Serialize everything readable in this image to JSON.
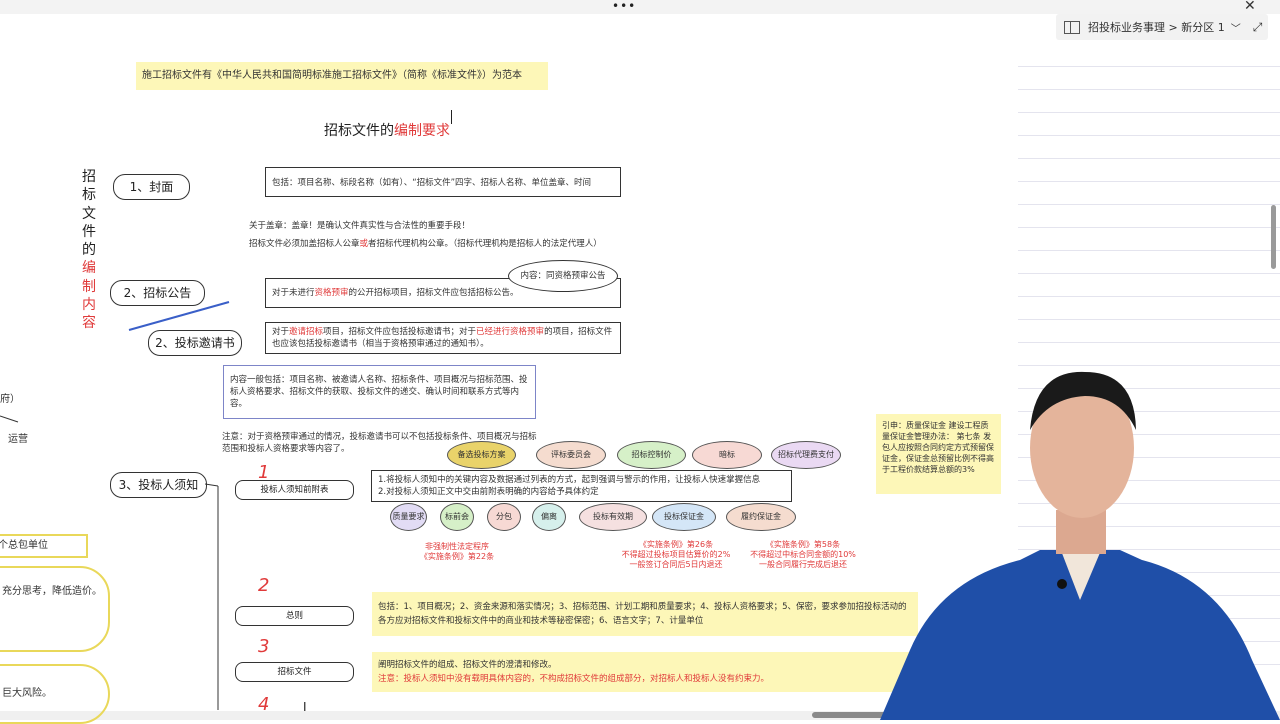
{
  "window": {
    "breadcrumb": "招投标业务事理 > 新分区 1"
  },
  "page": {
    "top_note": "施工招标文件有《中华人民共和国简明标准施工招标文件》（简称《标准文件》）为范本",
    "title_black": "招标文件的",
    "title_red": "编制要求",
    "vertical_title_black": [
      "招",
      "标",
      "文",
      "件",
      "的"
    ],
    "vertical_title_red": [
      "编",
      "制",
      "内",
      "容"
    ],
    "sections": {
      "cover": {
        "label": "1、封面",
        "content": "包括：项目名称、标段名称（如有）、“招标文件”四字、招标人名称、单位盖章、时间",
        "note1": "关于盖章：盖章！是确认文件真实性与合法性的重要手段！",
        "note2_a": "招标文件必须加盖招标人公章",
        "note2_red": "或",
        "note2_b": "者招标代理机构公章。（招标代理机构是招标人的法定代理人）"
      },
      "announcement": {
        "label": "2、招标公告",
        "bubble": "内容：同资格预审公告",
        "content_a": "对于未进行",
        "content_red": "资格预审",
        "content_b": "的公开招标项目，招标文件应包括招标公告。"
      },
      "invitation": {
        "label": "2、投标邀请书",
        "content_a": "对于",
        "content_red1": "邀请招标",
        "content_b": "项目，招标文件应包括投标邀请书；对于",
        "content_red2": "已经进行资格预审",
        "content_c": "的项目，招标文件也应该包括投标邀请书（相当于资格预审通过的通知书）。",
        "detail": "内容一般包括：项目名称、被邀请人名称、招标条件、项目概况与招标范围、投标人资格要求、招标文件的获取、投标文件的递交、确认时间和联系方式等内容。",
        "remark": "注意：对于资格预审通过的情况，投标邀请书可以不包括投标条件、项目概况与招标范围和投标人资格要求等内容了。"
      },
      "instructions": {
        "label": "3、投标人须知",
        "items": [
          {
            "num": "1",
            "label": "投标人须知前附表"
          },
          {
            "num": "2",
            "label": "总则"
          },
          {
            "num": "3",
            "label": "招标文件"
          },
          {
            "num": "4",
            "label": ""
          }
        ],
        "attached_note1": "1.将投标人须知中的关键内容及数据通过列表的方式，起到强调与警示的作用，让投标人快速掌握信息",
        "attached_note2": "2.对投标人须知正文中交由前附表明确的内容给予具体约定",
        "chips_row1": [
          "备选投标方案",
          "评标委员会",
          "招标控制价",
          "暗标",
          "招标代理费支付"
        ],
        "chips_row2": [
          "质量要求",
          "标前会",
          "分包",
          "偏离",
          "投标有效期",
          "投标保证金",
          "履约保证金"
        ],
        "cap1_a": "非强制性法定程序",
        "cap1_b": "《实施条例》第22条",
        "cap2_a": "《实施条例》第26条",
        "cap2_b": "不得超过投标项目估算价的2%",
        "cap2_c": "一般签订合同后5日内退还",
        "cap3_a": "《实施条例》第58条",
        "cap3_b": "不得超过中标合同金额的10%",
        "cap3_c": "一般合同履行完成后退还",
        "general_content_a": "包括：1、项目概况；2、资金来源和落实情况；3、招标范围、计划工期和质量要求；4、投标人资格要求；5、保密，要求参加招投标活动的各方应对招标文件和投标文件中的商业和技术等秘密保密；6、语言文字；7、计量单位",
        "docs_content": "阐明招标文件的组成、招标文件的澄清和修改。",
        "docs_note": "注意：投标人须知中没有载明具体内容的，不构成招标文件的组成部分，对招标人和投标人没有约束力。"
      }
    },
    "side_note": "引申：质量保证金 建设工程质量保证金管理办法： 第七条 发包人应按照合同约定方式预留保证金，保证金总预留比例不得高于工程价款结算总额的3%",
    "left_fragments": [
      "府）",
      "运营",
      "个总包单位",
      "充分思考，降低造价。",
      "巨大风险。"
    ]
  },
  "colors": {
    "sticky": "#fdf7b8",
    "accent_red": "#e03a3a",
    "chip_gold": "#e9d36a",
    "chip_peach": "#f5dccf",
    "chip_green": "#d6f0c8",
    "chip_pink": "#f7d9d4",
    "chip_lilac": "#ead9f3",
    "chip_blue": "#d4e6f7",
    "chip_teal": "#d6f0ec"
  }
}
